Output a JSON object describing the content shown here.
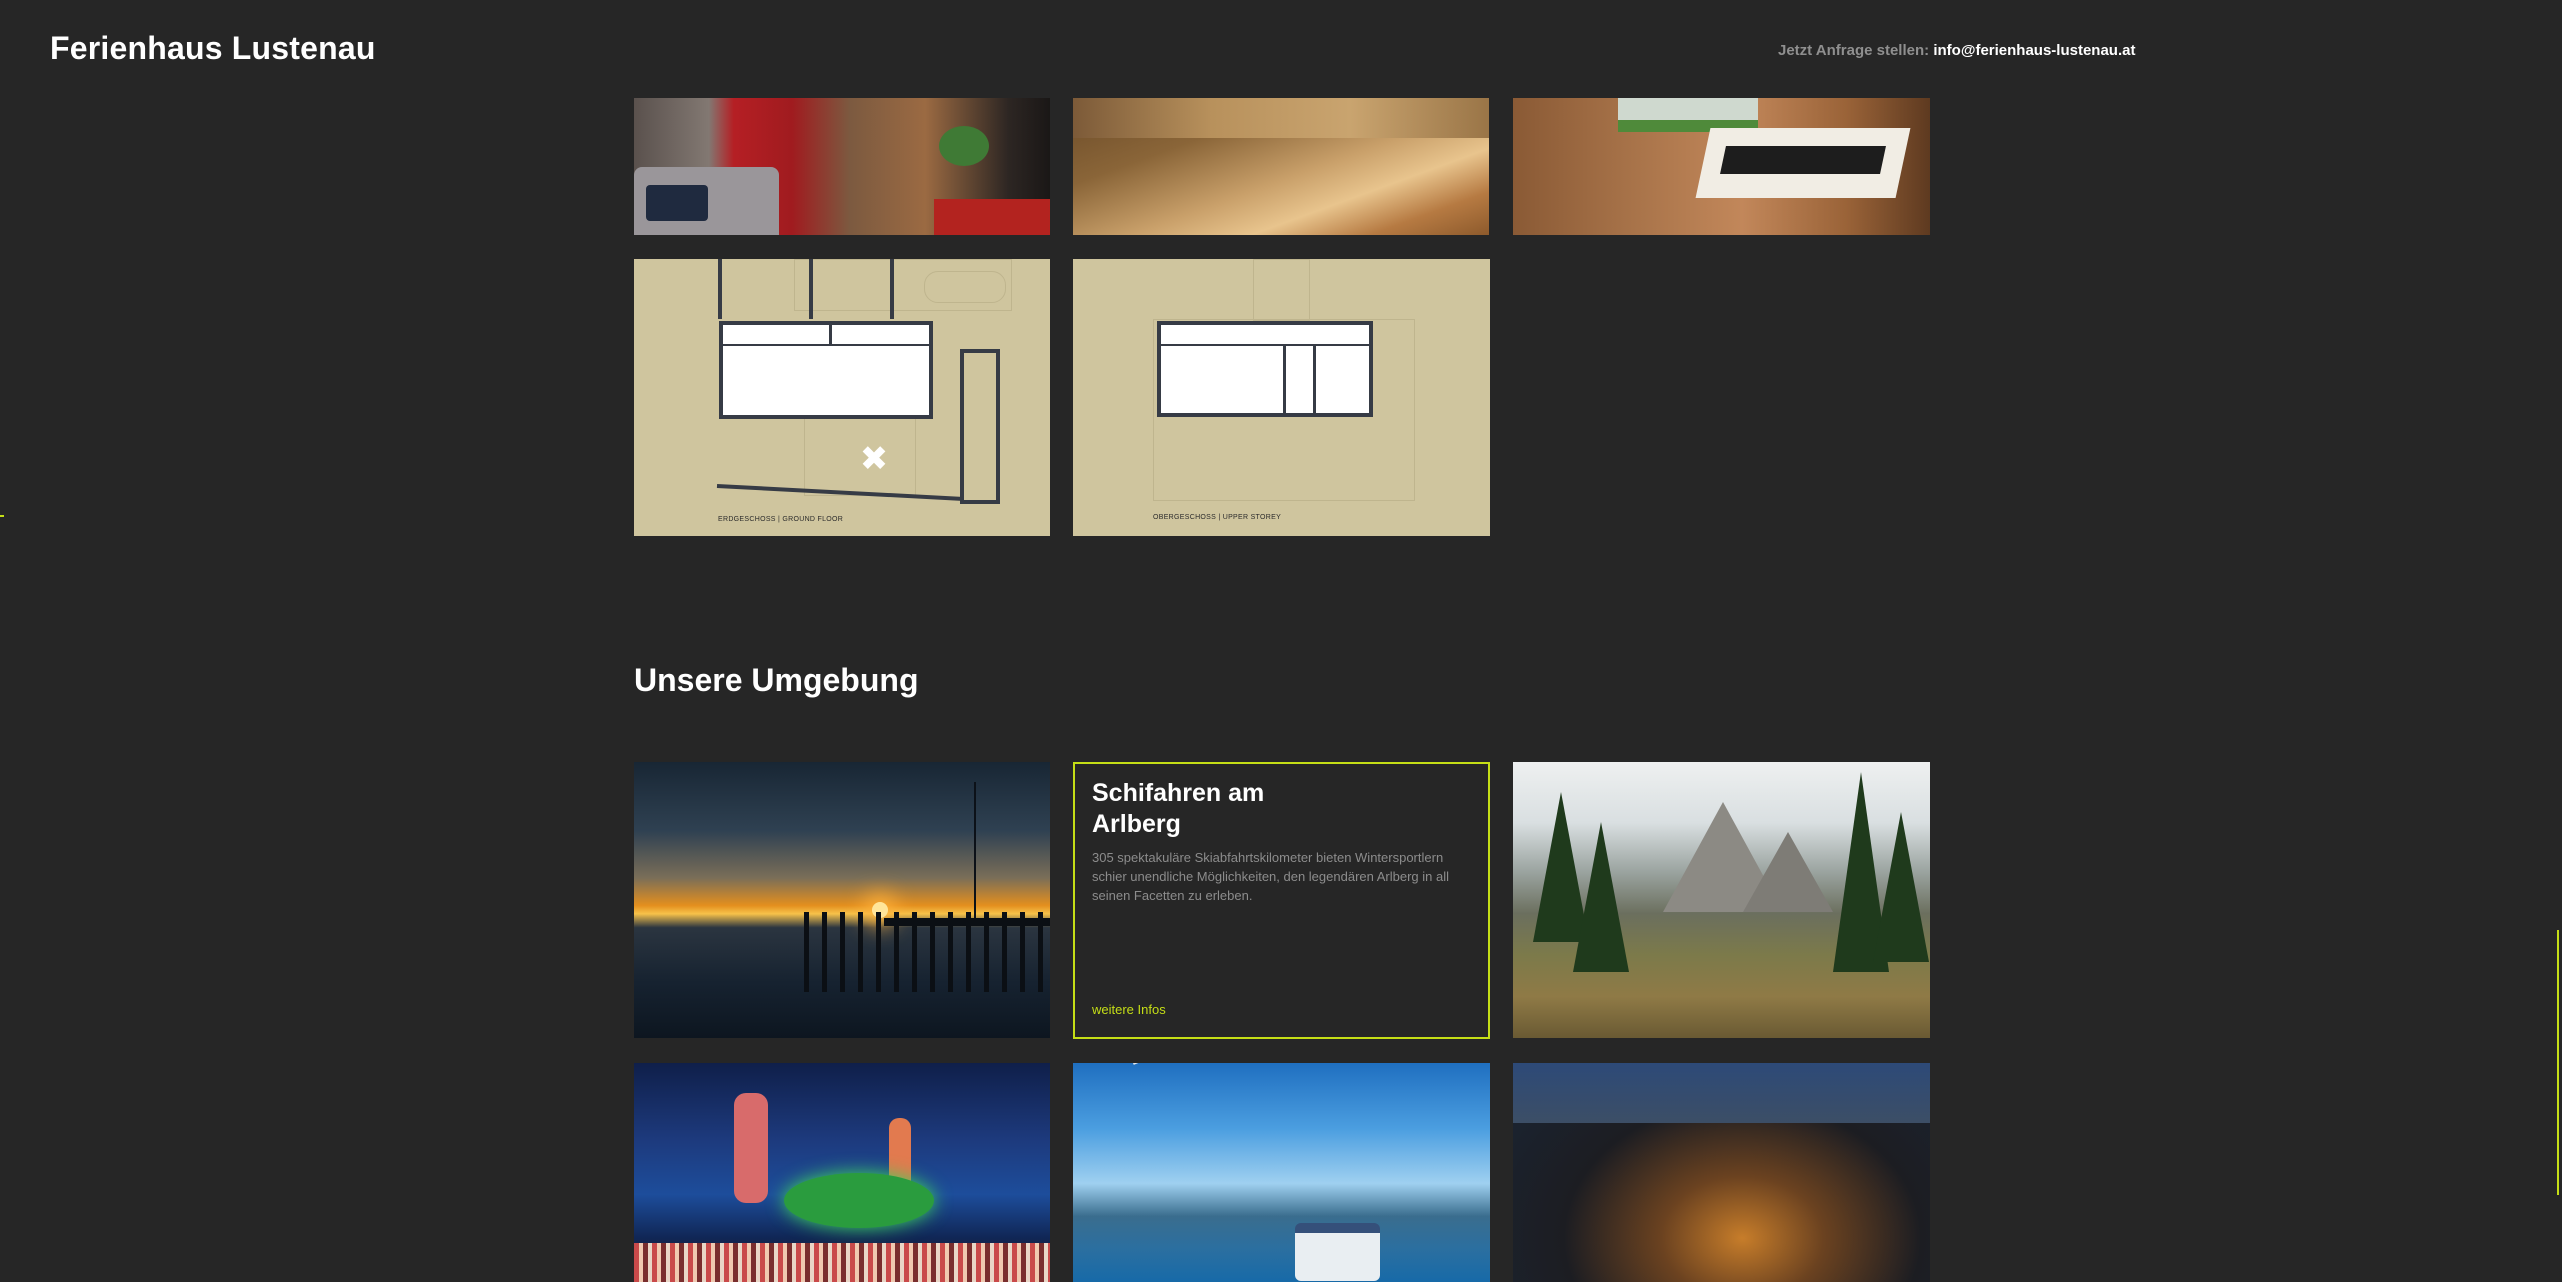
{
  "header": {
    "brand": "Ferienhaus Lustenau",
    "contact_label": "Jetzt Anfrage stellen:",
    "contact_email": "info@ferienhaus-lustenau.at"
  },
  "gallery": {
    "plans": [
      {
        "label": "ERDGESCHOSS | GROUND FLOOR"
      },
      {
        "label": "OBERGESCHOSS | UPPER STOREY"
      }
    ]
  },
  "surroundings": {
    "title": "Unsere Umgebung",
    "card": {
      "title": "Schifahren am Arlberg",
      "text": "305 spektakuläre Skiabfahrtskilometer bieten Wintersportlern schier unendliche Möglichkeiten, den legendären Arlberg in all seinen Facetten zu erleben.",
      "link": "weitere Infos"
    }
  },
  "colors": {
    "background": "#262626",
    "accent": "#c5de16",
    "plan_background": "#cfc59e"
  },
  "icons": {
    "expand": "expand-arrows-icon"
  }
}
